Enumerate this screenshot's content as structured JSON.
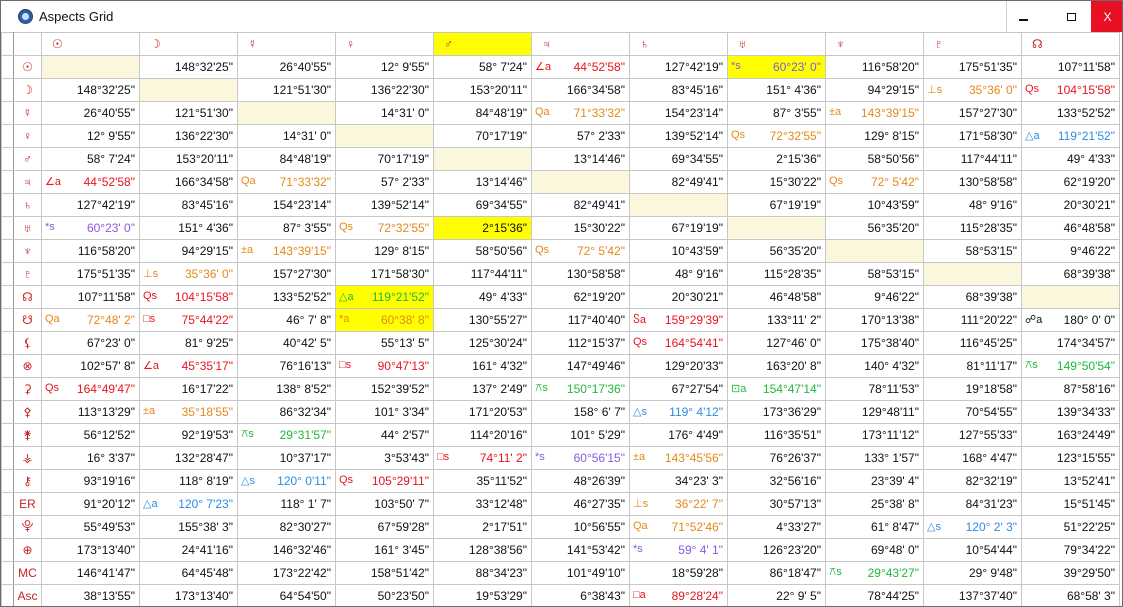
{
  "window": {
    "title": "Aspects Grid",
    "minimize_label": "",
    "maximize_label": "",
    "close_label": "X"
  },
  "columns": [
    "☉",
    "☽",
    "☿",
    "♀",
    "♂",
    "♃",
    "♄",
    "♅",
    "♆",
    "♇",
    "☊"
  ],
  "rows": [
    {
      "label": "☉",
      "cells": [
        "",
        "148°32'25\"",
        "26°40'55\"",
        "12° 9'55\"",
        "58° 7'24\"",
        {
          "a": "∠a",
          "v": "44°52'58\"",
          "c": "red"
        },
        "127°42'19\"",
        {
          "a": "*s",
          "v": "60°23' 0\"",
          "c": "purple",
          "hl": true
        },
        "116°58'20\"",
        "175°51'35\"",
        "107°11'58\""
      ]
    },
    {
      "label": "☽",
      "cells": [
        "148°32'25\"",
        "",
        "121°51'30\"",
        "136°22'30\"",
        "153°20'11\"",
        "166°34'58\"",
        "83°45'16\"",
        "151° 4'36\"",
        "94°29'15\"",
        {
          "a": "⊥s",
          "v": "35°36' 0\"",
          "c": "orange"
        },
        {
          "a": "Qs",
          "v": "104°15'58\"",
          "c": "red"
        }
      ]
    },
    {
      "label": "☿",
      "cells": [
        "26°40'55\"",
        "121°51'30\"",
        "",
        "14°31' 0\"",
        "84°48'19\"",
        {
          "a": "Qa",
          "v": "71°33'32\"",
          "c": "orange"
        },
        "154°23'14\"",
        "87° 3'55\"",
        {
          "a": "±a",
          "v": "143°39'15\"",
          "c": "orange"
        },
        "157°27'30\"",
        "133°52'52\""
      ]
    },
    {
      "label": "♀",
      "cells": [
        "12° 9'55\"",
        "136°22'30\"",
        "14°31' 0\"",
        "",
        "70°17'19\"",
        "57° 2'33\"",
        "139°52'14\"",
        {
          "a": "Qs",
          "v": "72°32'55\"",
          "c": "orange"
        },
        "129° 8'15\"",
        "171°58'30\"",
        {
          "a": "△a",
          "v": "119°21'52\"",
          "c": "blue"
        }
      ]
    },
    {
      "label": "♂",
      "cells": [
        "58° 7'24\"",
        "153°20'11\"",
        "84°48'19\"",
        "70°17'19\"",
        "",
        "13°14'46\"",
        "69°34'55\"",
        "2°15'36\"",
        "58°50'56\"",
        "117°44'11\"",
        "49° 4'33\""
      ]
    },
    {
      "label": "♃",
      "cells": [
        {
          "a": "∠a",
          "v": "44°52'58\"",
          "c": "red"
        },
        "166°34'58\"",
        {
          "a": "Qa",
          "v": "71°33'32\"",
          "c": "orange"
        },
        "57° 2'33\"",
        "13°14'46\"",
        "",
        "82°49'41\"",
        "15°30'22\"",
        {
          "a": "Qs",
          "v": "72° 5'42\"",
          "c": "orange"
        },
        "130°58'58\"",
        "62°19'20\""
      ]
    },
    {
      "label": "♄",
      "cells": [
        "127°42'19\"",
        "83°45'16\"",
        "154°23'14\"",
        "139°52'14\"",
        "69°34'55\"",
        "82°49'41\"",
        "",
        "67°19'19\"",
        "10°43'59\"",
        "48° 9'16\"",
        "20°30'21\""
      ]
    },
    {
      "label": "♅",
      "cells": [
        {
          "a": "*s",
          "v": "60°23' 0\"",
          "c": "purple"
        },
        "151° 4'36\"",
        "87° 3'55\"",
        {
          "a": "Qs",
          "v": "72°32'55\"",
          "c": "orange"
        },
        {
          "v": "2°15'36\"",
          "hl": true
        },
        "15°30'22\"",
        "67°19'19\"",
        "",
        "56°35'20\"",
        "115°28'35\"",
        "46°48'58\""
      ]
    },
    {
      "label": "♆",
      "cells": [
        "116°58'20\"",
        "94°29'15\"",
        {
          "a": "±a",
          "v": "143°39'15\"",
          "c": "orange"
        },
        "129° 8'15\"",
        "58°50'56\"",
        {
          "a": "Qs",
          "v": "72° 5'42\"",
          "c": "orange"
        },
        "10°43'59\"",
        "56°35'20\"",
        "",
        "58°53'15\"",
        "9°46'22\""
      ]
    },
    {
      "label": "♇",
      "cells": [
        "175°51'35\"",
        {
          "a": "⊥s",
          "v": "35°36' 0\"",
          "c": "orange"
        },
        "157°27'30\"",
        "171°58'30\"",
        "117°44'11\"",
        "130°58'58\"",
        "48° 9'16\"",
        "115°28'35\"",
        "58°53'15\"",
        "",
        "68°39'38\""
      ]
    },
    {
      "label": "☊",
      "cells": [
        "107°11'58\"",
        {
          "a": "Qs",
          "v": "104°15'58\"",
          "c": "red"
        },
        "133°52'52\"",
        {
          "a": "△a",
          "v": "119°21'52\"",
          "c": "green",
          "hl": true
        },
        "49° 4'33\"",
        "62°19'20\"",
        "20°30'21\"",
        "46°48'58\"",
        "9°46'22\"",
        "68°39'38\"",
        ""
      ]
    },
    {
      "label": "☋",
      "cells": [
        {
          "a": "Qa",
          "v": "72°48' 2\"",
          "c": "orange"
        },
        {
          "a": "□s",
          "v": "75°44'22\"",
          "c": "red"
        },
        "46° 7' 8\"",
        {
          "a": "*a",
          "v": "60°38' 8\"",
          "c": "orange",
          "hl": true
        },
        "130°55'27\"",
        "117°40'40\"",
        {
          "a": "Ⴝa",
          "v": "159°29'39\"",
          "c": "red"
        },
        "133°11' 2\"",
        "170°13'38\"",
        "111°20'22\"",
        {
          "a": "☍a",
          "v": "180° 0' 0\"",
          "c": "black"
        }
      ]
    },
    {
      "label": "⚸",
      "cells": [
        "67°23' 0\"",
        "81° 9'25\"",
        "40°42' 5\"",
        "55°13' 5\"",
        "125°30'24\"",
        "112°15'37\"",
        {
          "a": "Qs",
          "v": "164°54'41\"",
          "c": "red"
        },
        "127°46' 0\"",
        "175°38'40\"",
        "116°45'25\"",
        "174°34'57\""
      ]
    },
    {
      "label": "⊗",
      "cells": [
        "102°57' 8\"",
        {
          "a": "∠a",
          "v": "45°35'17\"",
          "c": "red"
        },
        "76°16'13\"",
        {
          "a": "□s",
          "v": "90°47'13\"",
          "c": "red"
        },
        "161° 4'32\"",
        "147°49'46\"",
        "129°20'33\"",
        "163°20' 8\"",
        "140° 4'32\"",
        "81°11'17\"",
        {
          "a": "⚻s",
          "v": "149°50'54\"",
          "c": "green"
        }
      ]
    },
    {
      "label": "⚳",
      "cells": [
        {
          "a": "Qs",
          "v": "164°49'47\"",
          "c": "red"
        },
        "16°17'22\"",
        "138° 8'52\"",
        "152°39'52\"",
        "137° 2'49\"",
        {
          "a": "⚻s",
          "v": "150°17'36\"",
          "c": "green"
        },
        "67°27'54\"",
        {
          "a": "⊡a",
          "v": "154°47'14\"",
          "c": "green"
        },
        "78°11'53\"",
        "19°18'58\"",
        "87°58'16\""
      ]
    },
    {
      "label": "⚴",
      "cells": [
        "113°13'29\"",
        {
          "a": "±a",
          "v": "35°18'55\"",
          "c": "orange"
        },
        "86°32'34\"",
        "101° 3'34\"",
        "171°20'53\"",
        "158° 6' 7\"",
        {
          "a": "△s",
          "v": "119° 4'12\"",
          "c": "blue"
        },
        "173°36'29\"",
        "129°48'11\"",
        "70°54'55\"",
        "139°34'33\""
      ]
    },
    {
      "label": "⚵",
      "cells": [
        "56°12'52\"",
        "92°19'53\"",
        {
          "a": "⚻s",
          "v": "29°31'57\"",
          "c": "green"
        },
        "44° 2'57\"",
        "114°20'16\"",
        "101° 5'29\"",
        "176° 4'49\"",
        "116°35'51\"",
        "173°11'12\"",
        "127°55'33\"",
        "163°24'49\""
      ]
    },
    {
      "label": "⚶",
      "cells": [
        "16° 3'37\"",
        "132°28'47\"",
        "10°37'17\"",
        "3°53'43\"",
        {
          "a": "□s",
          "v": "74°11' 2\"",
          "c": "red"
        },
        {
          "a": "*s",
          "v": "60°56'15\"",
          "c": "purple"
        },
        {
          "a": "±a",
          "v": "143°45'56\"",
          "c": "orange"
        },
        "76°26'37\"",
        "133° 1'57\"",
        "168° 4'47\"",
        "123°15'55\""
      ]
    },
    {
      "label": "⚷",
      "cells": [
        "93°19'16\"",
        "118° 8'19\"",
        {
          "a": "△s",
          "v": "120° 0'11\"",
          "c": "blue"
        },
        {
          "a": "Qs",
          "v": "105°29'11\"",
          "c": "red"
        },
        "35°11'52\"",
        "48°26'39\"",
        "34°23' 3\"",
        "32°56'16\"",
        "23°39' 4\"",
        "82°32'19\"",
        "13°52'41\""
      ]
    },
    {
      "label": "ER",
      "cells": [
        "91°20'12\"",
        {
          "a": "△a",
          "v": "120° 7'23\"",
          "c": "blue"
        },
        "118° 1' 7\"",
        "103°50' 7\"",
        "33°12'48\"",
        "46°27'35\"",
        {
          "a": "⊥s",
          "v": "36°22' 7\"",
          "c": "orange"
        },
        "30°57'13\"",
        "25°38' 8\"",
        "84°31'23\"",
        "15°51'45\""
      ]
    },
    {
      "label": "⯓",
      "cells": [
        "55°49'53\"",
        "155°38' 3\"",
        "82°30'27\"",
        "67°59'28\"",
        "2°17'51\"",
        "10°56'55\"",
        {
          "a": "Qa",
          "v": "71°52'46\"",
          "c": "orange"
        },
        "4°33'27\"",
        "61° 8'47\"",
        {
          "a": "△s",
          "v": "120° 2' 3\"",
          "c": "blue"
        },
        "51°22'25\""
      ]
    },
    {
      "label": "⊕",
      "cells": [
        "173°13'40\"",
        "24°41'16\"",
        "146°32'46\"",
        "161° 3'45\"",
        "128°38'56\"",
        "141°53'42\"",
        {
          "a": "*s",
          "v": "59° 4' 1\"",
          "c": "purple"
        },
        "126°23'20\"",
        "69°48' 0\"",
        "10°54'44\"",
        "79°34'22\""
      ]
    },
    {
      "label": "MC",
      "cells": [
        "146°41'47\"",
        "64°45'48\"",
        "173°22'42\"",
        "158°51'42\"",
        "88°34'23\"",
        "101°49'10\"",
        "18°59'28\"",
        "86°18'47\"",
        {
          "a": "⚻s",
          "v": "29°43'27\"",
          "c": "green"
        },
        "29° 9'48\"",
        "39°29'50\""
      ]
    },
    {
      "label": "Asc",
      "cells": [
        "38°13'55\"",
        "173°13'40\"",
        "64°54'50\"",
        "50°23'50\"",
        "19°53'29\"",
        "6°38'43\"",
        {
          "a": "□a",
          "v": "89°28'24\"",
          "c": "red"
        },
        "22° 9' 5\"",
        "78°44'25\"",
        "137°37'40\"",
        "68°58' 3\""
      ]
    }
  ]
}
